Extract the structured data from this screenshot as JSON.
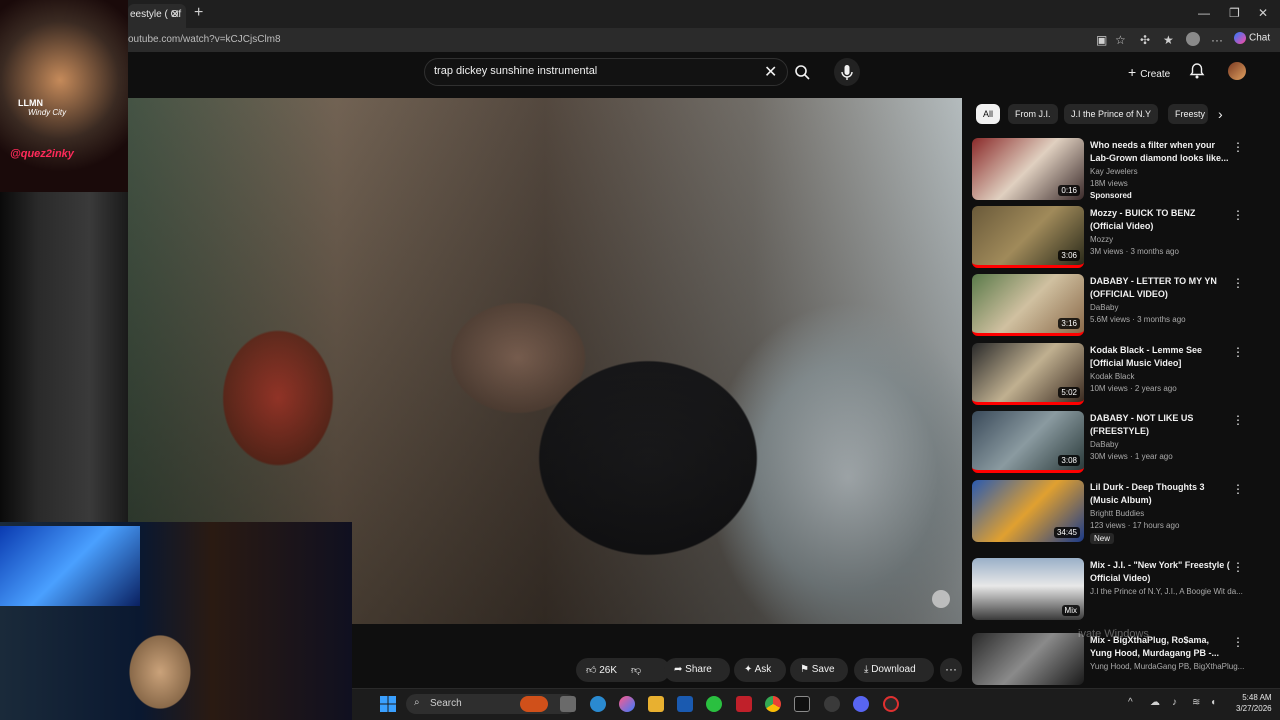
{
  "browser": {
    "tab_title": "eestyle ( Of",
    "url": "outube.com/watch?v=kCJCjsClm8",
    "chat_label": "Chat"
  },
  "header": {
    "search_query": "trap dickey sunshine instrumental",
    "create_label": "Create"
  },
  "overlay": {
    "logo_line1": "LLMN",
    "logo_line2": "Windy City",
    "logo_handle": "@quez2inky"
  },
  "actions": {
    "like_count": "26K",
    "share": "Share",
    "ask": "Ask",
    "save": "Save",
    "download": "Download"
  },
  "chips": [
    "All",
    "From J.I.",
    "J.I the Prince of N.Y",
    "Freesty"
  ],
  "recommendations": [
    {
      "title": "Who needs a filter when your Lab-Grown diamond looks like...",
      "channel": "Kay Jewelers",
      "meta": "18M views",
      "badge": "Sponsored",
      "duration": "0:16"
    },
    {
      "title": "Mozzy - BUICK TO BENZ (Official Video)",
      "channel": "Mozzy",
      "meta": "3M views · 3 months ago",
      "badge": "",
      "duration": "3:06"
    },
    {
      "title": "DABABY - LETTER TO MY YN (OFFICIAL VIDEO)",
      "channel": "DaBaby",
      "meta": "5.6M views · 3 months ago",
      "badge": "",
      "duration": "3:16"
    },
    {
      "title": "Kodak Black - Lemme See [Official Music Video]",
      "channel": "Kodak Black",
      "meta": "10M views · 2 years ago",
      "badge": "",
      "duration": "5:02"
    },
    {
      "title": "DABABY - NOT LIKE US (FREESTYLE)",
      "channel": "DaBaby",
      "meta": "30M views · 1 year ago",
      "badge": "",
      "duration": "3:08"
    },
    {
      "title": "Lil Durk - Deep Thoughts 3 (Music Album)",
      "channel": "Brightt Buddies",
      "meta": "123 views · 17 hours ago",
      "badge": "New",
      "duration": "34:45"
    },
    {
      "title": "Mix - J.I. - \"New York\" Freestyle ( Official Video)",
      "channel": "J.I the Prince of N.Y, J.I., A Boogie Wit da...",
      "meta": "",
      "badge": "",
      "duration": "Mix"
    },
    {
      "title": "Mix - BigXthaPlug, Ro$ama, Yung Hood, Murdagang PB -...",
      "channel": "Yung Hood, MurdaGang PB, BigXthaPlug...",
      "meta": "",
      "badge": "",
      "duration": ""
    }
  ],
  "watermark": "ivate Windows",
  "taskbar": {
    "search_placeholder": "Search",
    "time": "5:48 AM",
    "date": "3/27/2026"
  },
  "colors": {
    "background": "#0f0f0f",
    "chip_active": "#f1f1f1",
    "progress_red": "#ff0000"
  }
}
